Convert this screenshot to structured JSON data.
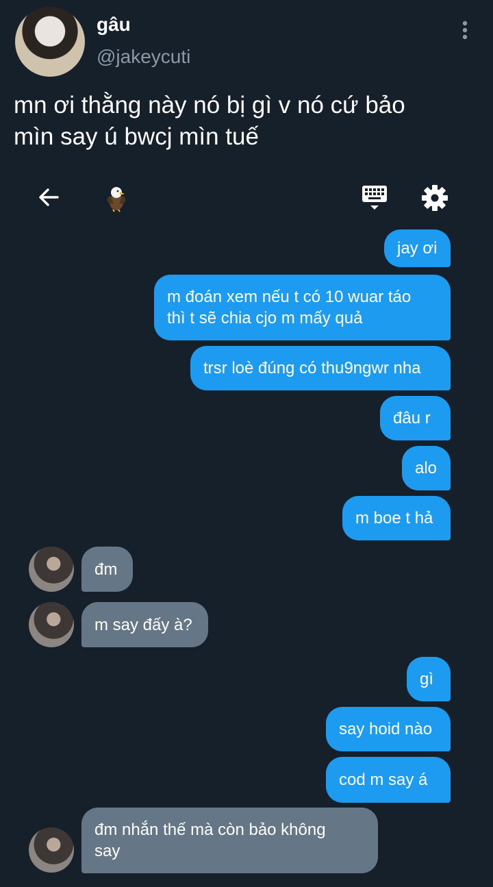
{
  "tweet": {
    "display_name": "gâu",
    "handle": "@jakeycuti",
    "text": "mn ơi thằng này nó bị gì v nó cứ bảo\nmìn say ú bwcj mìn tuế"
  },
  "dm_toolbar": {
    "back_icon": "arrow-left",
    "contact_emoji": "🦅",
    "keyboard_icon": "keyboard",
    "settings_icon": "gear"
  },
  "colors": {
    "background": "#15202b",
    "outgoing_bubble": "#1d9bf0",
    "incoming_bubble": "#657786",
    "secondary_text": "#8b98a5"
  },
  "messages": [
    {
      "direction": "outgoing",
      "text": "jay ơi"
    },
    {
      "direction": "outgoing",
      "text": "m đoán xem nếu t có 10 wuar táo\nthì t sẽ chia cjo m mấy quả"
    },
    {
      "direction": "outgoing",
      "text": "trsr loè đúng có thu9ngwr nha"
    },
    {
      "direction": "outgoing",
      "text": "đâu r"
    },
    {
      "direction": "outgoing",
      "text": "alo"
    },
    {
      "direction": "outgoing",
      "text": "m boe t hả"
    },
    {
      "direction": "incoming",
      "text": "đm"
    },
    {
      "direction": "incoming",
      "text": "m say đấy à?"
    },
    {
      "direction": "outgoing",
      "text": "gì"
    },
    {
      "direction": "outgoing",
      "text": "say hoid nào"
    },
    {
      "direction": "outgoing",
      "text": "cod  m say á"
    },
    {
      "direction": "incoming",
      "text": "đm nhắn thế mà còn bảo không\nsay"
    }
  ]
}
